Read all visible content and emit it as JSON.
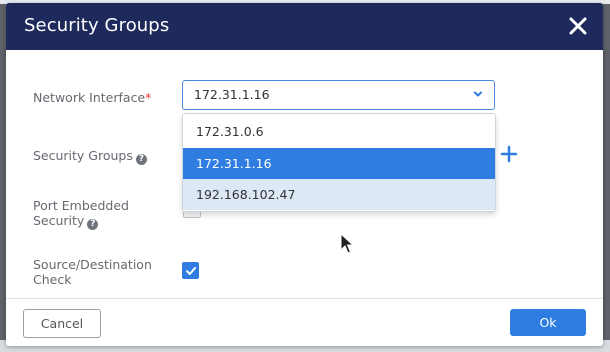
{
  "dialog": {
    "title": "Security Groups"
  },
  "form": {
    "network_interface": {
      "label": "Network Interface",
      "required_marker": "*",
      "selected_value": "172.31.1.16",
      "options": [
        "172.31.0.6",
        "172.31.1.16",
        "192.168.102.47"
      ],
      "highlighted_option": "172.31.1.16",
      "hovered_option": "192.168.102.47"
    },
    "security_groups": {
      "label": "Security Groups"
    },
    "port_embedded_security": {
      "label_line1": "Port Embedded",
      "label_line2": "Security"
    },
    "source_destination_check": {
      "label_line1": "Source/Destination",
      "label_line2": "Check",
      "checked": true
    }
  },
  "footer": {
    "cancel_label": "Cancel",
    "ok_label": "Ok"
  },
  "colors": {
    "header_bg": "#1f2a5c",
    "accent": "#2f7de1",
    "hover_bg": "#dde8f7",
    "required": "#e63a3a"
  },
  "icons": {
    "close": "close-icon",
    "chevron": "chevron-down-icon",
    "help": "help-icon",
    "add": "plus-icon",
    "check": "checkmark-icon",
    "cursor": "mouse-pointer-icon"
  }
}
